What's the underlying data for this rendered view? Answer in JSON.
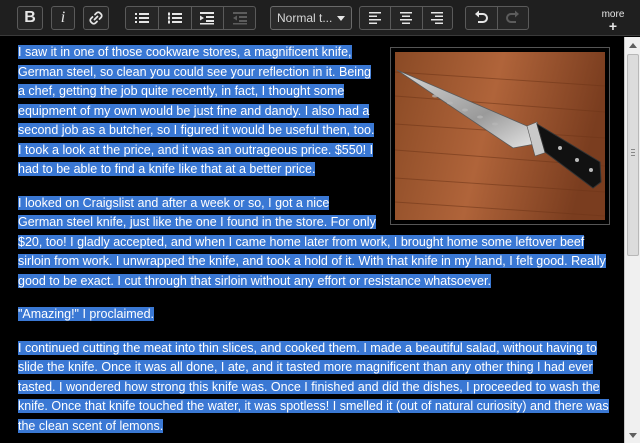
{
  "toolbar": {
    "bold_label": "B",
    "italic_label": "i",
    "format_select_value": "Normal t...",
    "more_label": "more",
    "more_plus": "+"
  },
  "article": {
    "paragraphs": [
      "I saw it in one of those cookware stores, a magnificent knife, German steel, so clean you could see your reflection in it. Being a chef, getting the job quite recently, in fact, I thought some equipment of my own would be just fine and dandy. I also had a second job as a butcher, so I figured it would be useful then, too. I took a look at the price, and it was an outrageous price. $550! I had to be able to find a knife like that at a better price.",
      "I looked on Craigslist and after a week or so, I got a nice German steel knife, just like the one I found in the store. For only $20, too! I gladly accepted, and when I came home later from work, I brought home some leftover beef sirloin from work. I unwrapped the knife, and took a hold of it. With that knife in my hand, I felt good. Really good to be exact. I cut through that sirloin without any effort or resistance whatsoever.",
      "\"Amazing!\" I proclaimed.",
      "I continued cutting the meat into thin slices, and cooked them. I made a beautiful salad, without having to slide the knife. Once it was all done, I ate, and it tasted more magnificent than any other thing I had ever tasted. I wondered how strong this knife was. Once I finished and did the dishes, I proceeded to wash the knife. Once that knife touched the water, it was spotless! I smelled it (out of natural curiosity) and there was the clean scent of lemons."
    ]
  },
  "colors": {
    "selection": "#3a78d4",
    "editor_background": "#000000",
    "toolbar_background": "#1f1f1f"
  }
}
